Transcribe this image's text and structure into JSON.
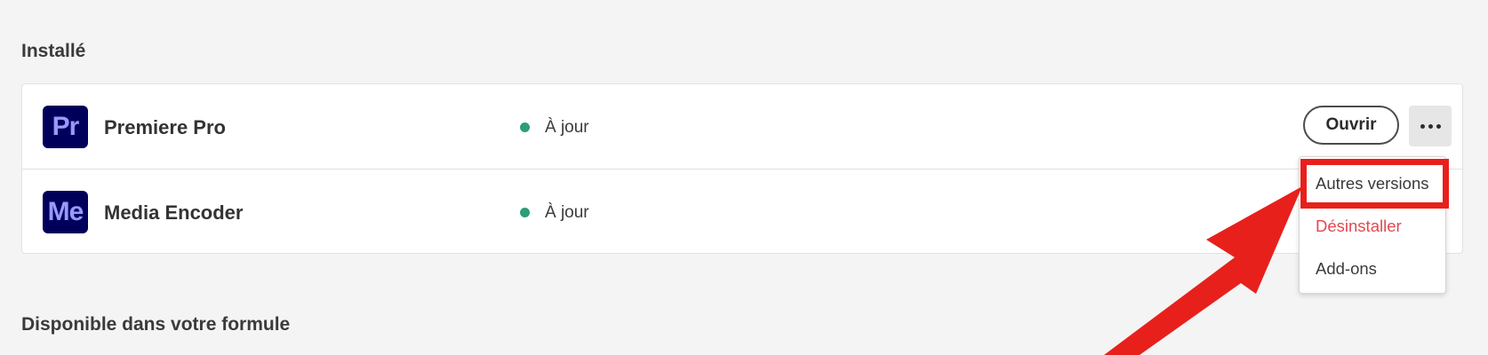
{
  "sections": {
    "installed_title": "Installé",
    "available_title": "Disponible dans votre formule"
  },
  "apps": [
    {
      "logo": "Pr",
      "name": "Premiere Pro",
      "status": "À jour",
      "status_color": "#2d9d78"
    },
    {
      "logo": "Me",
      "name": "Media Encoder",
      "status": "À jour",
      "status_color": "#2d9d78"
    }
  ],
  "actions": {
    "open_label": "Ouvrir",
    "more_icon": "more-horizontal-icon"
  },
  "menu": {
    "items": [
      {
        "label": "Autres versions",
        "color": "#3a3a3a"
      },
      {
        "label": "Désinstaller",
        "color": "#e34850"
      },
      {
        "label": "Add-ons",
        "color": "#3a3a3a"
      }
    ]
  },
  "annotation": {
    "highlight_color": "#e8201c",
    "arrow_color": "#e8201c"
  },
  "colors": {
    "app_logo_bg": "#00005b",
    "app_logo_fg": "#9999ff",
    "page_bg": "#f4f4f4"
  }
}
